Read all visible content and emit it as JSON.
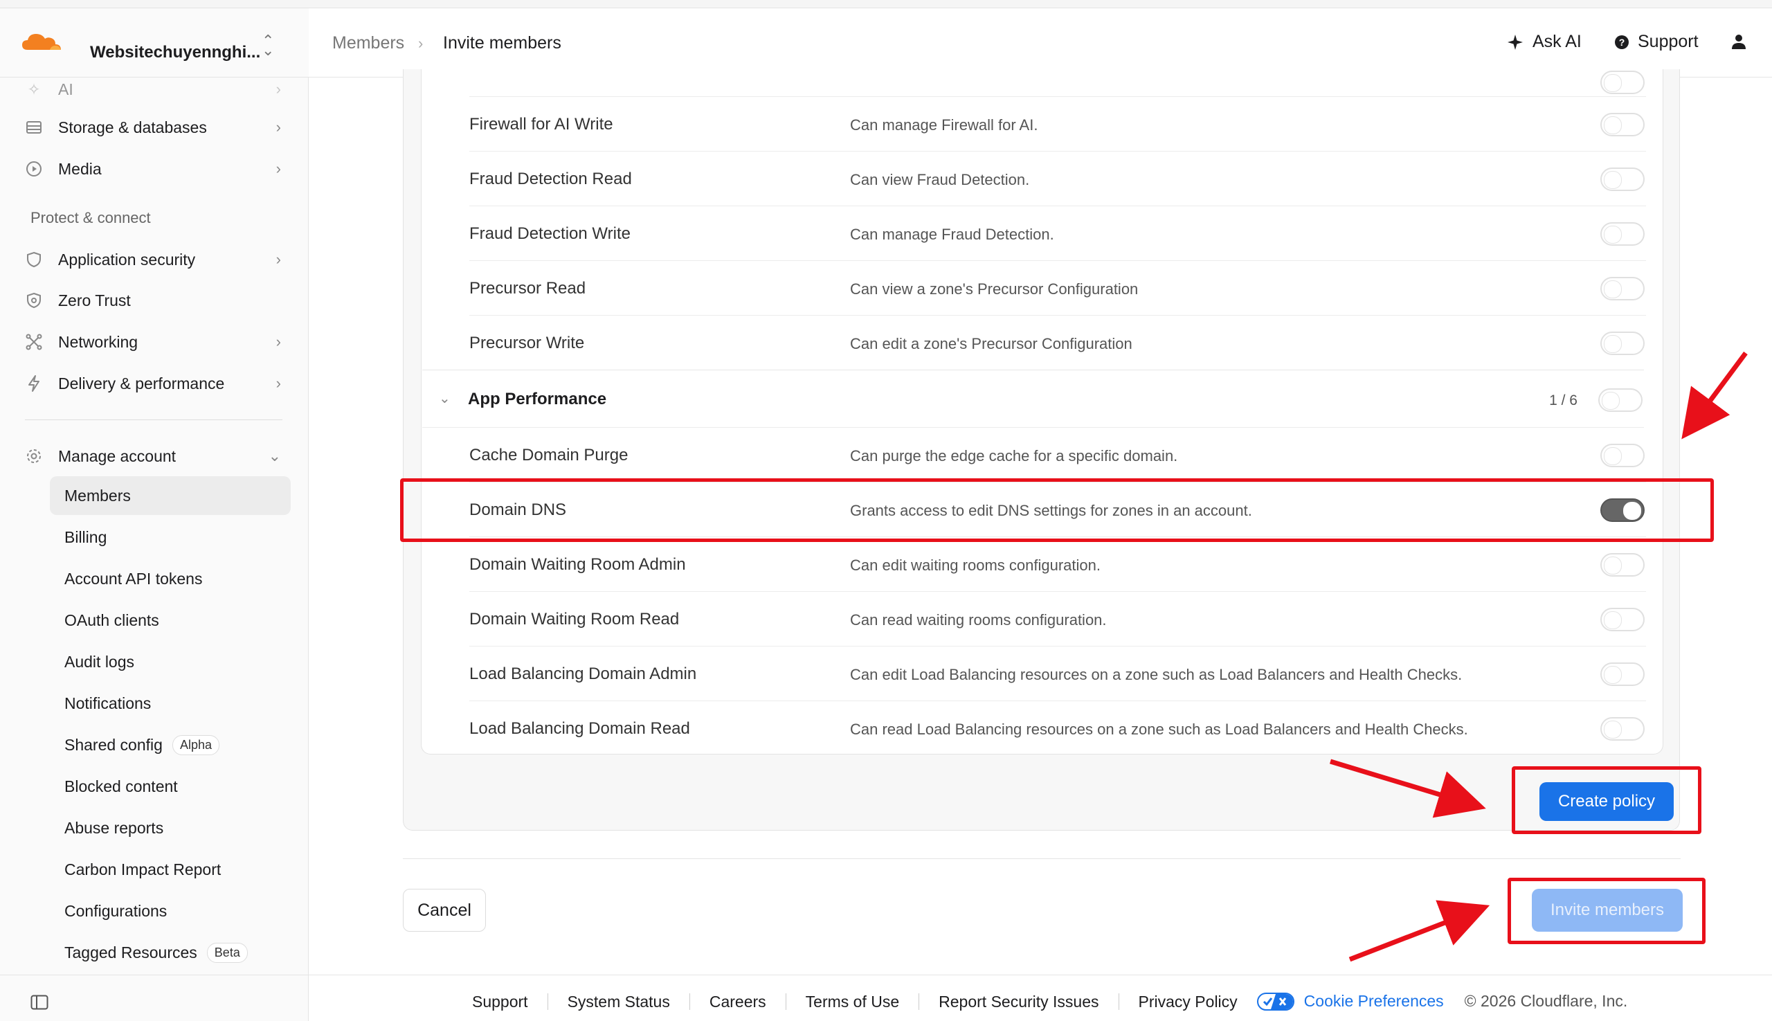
{
  "account": {
    "name": "Websitechuyennghi..."
  },
  "breadcrumb": {
    "parent": "Members",
    "current": "Invite members"
  },
  "header": {
    "ask_ai": "Ask AI",
    "support": "Support"
  },
  "sidebar": {
    "top_item_partial": "AI",
    "items_top": [
      {
        "label": "Storage & databases",
        "icon": "database-icon"
      },
      {
        "label": "Media",
        "icon": "play-icon"
      }
    ],
    "section_protect": "Protect & connect",
    "items_protect": [
      {
        "label": "Application security",
        "icon": "shield-icon"
      },
      {
        "label": "Zero Trust",
        "icon": "zero-trust-icon"
      },
      {
        "label": "Networking",
        "icon": "network-icon"
      },
      {
        "label": "Delivery & performance",
        "icon": "lightning-icon"
      }
    ],
    "manage_account": "Manage account",
    "sub_items": [
      {
        "label": "Members",
        "active": true
      },
      {
        "label": "Billing"
      },
      {
        "label": "Account API tokens"
      },
      {
        "label": "OAuth clients"
      },
      {
        "label": "Audit logs"
      },
      {
        "label": "Notifications"
      },
      {
        "label": "Shared config",
        "badge": "Alpha"
      },
      {
        "label": "Blocked content"
      },
      {
        "label": "Abuse reports"
      },
      {
        "label": "Carbon Impact Report"
      },
      {
        "label": "Configurations"
      },
      {
        "label": "Tagged Resources",
        "badge": "Beta"
      }
    ]
  },
  "permissions_before": [
    {
      "name": "Firewall for AI Write",
      "desc": "Can manage Firewall for AI.",
      "enabled": false
    },
    {
      "name": "Fraud Detection Read",
      "desc": "Can view Fraud Detection.",
      "enabled": false
    },
    {
      "name": "Fraud Detection Write",
      "desc": "Can manage Fraud Detection.",
      "enabled": false
    },
    {
      "name": "Precursor Read",
      "desc": "Can view a zone's Precursor Configuration",
      "enabled": false
    },
    {
      "name": "Precursor Write",
      "desc": "Can edit a zone's Precursor Configuration",
      "enabled": false
    }
  ],
  "group": {
    "name": "App Performance",
    "count": "1 / 6",
    "enabled": false
  },
  "permissions_group": [
    {
      "name": "Cache Domain Purge",
      "desc": "Can purge the edge cache for a specific domain.",
      "enabled": false
    },
    {
      "name": "Domain DNS",
      "desc": "Grants access to edit DNS settings for zones in an account.",
      "enabled": true
    },
    {
      "name": "Domain Waiting Room Admin",
      "desc": "Can edit waiting rooms configuration.",
      "enabled": false
    },
    {
      "name": "Domain Waiting Room Read",
      "desc": "Can read waiting rooms configuration.",
      "enabled": false
    },
    {
      "name": "Load Balancing Domain Admin",
      "desc": "Can edit Load Balancing resources on a zone such as Load Balancers and Health Checks.",
      "enabled": false
    },
    {
      "name": "Load Balancing Domain Read",
      "desc": "Can read Load Balancing resources on a zone such as Load Balancers and Health Checks.",
      "enabled": false
    }
  ],
  "actions": {
    "create_policy": "Create policy",
    "cancel": "Cancel",
    "invite_members": "Invite members"
  },
  "footer": {
    "links": [
      "Support",
      "System Status",
      "Careers",
      "Terms of Use",
      "Report Security Issues",
      "Privacy Policy"
    ],
    "cookie": "Cookie Preferences",
    "copyright": "© 2026 Cloudflare, Inc."
  },
  "colors": {
    "accent": "#1a73e8",
    "annotation": "#e8101a",
    "brand": "#f38020"
  }
}
